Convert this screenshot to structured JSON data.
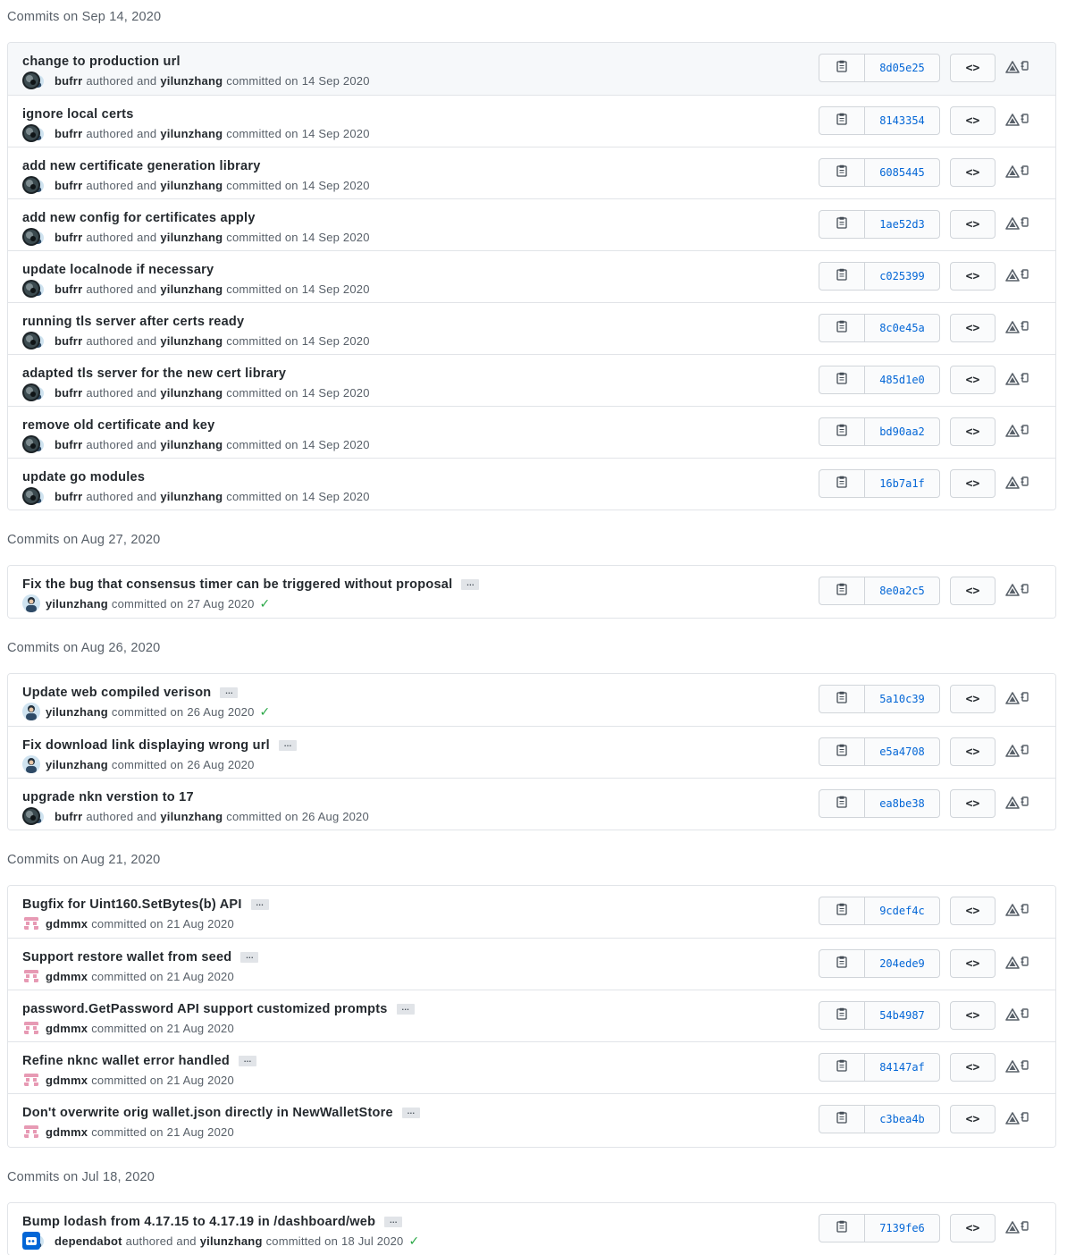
{
  "groups": [
    {
      "header": "Commits on Sep 14, 2020",
      "commits": [
        {
          "message": "change to production url",
          "ellipsis": false,
          "authors": [
            "bufrr",
            "yilunzhang"
          ],
          "date": "14 Sep 2020",
          "verified": false,
          "sha": "8d05e25",
          "avatar": "dark"
        },
        {
          "message": "ignore local certs",
          "ellipsis": false,
          "authors": [
            "bufrr",
            "yilunzhang"
          ],
          "date": "14 Sep 2020",
          "verified": false,
          "sha": "8143354",
          "avatar": "dark"
        },
        {
          "message": "add new certificate generation library",
          "ellipsis": false,
          "authors": [
            "bufrr",
            "yilunzhang"
          ],
          "date": "14 Sep 2020",
          "verified": false,
          "sha": "6085445",
          "avatar": "dark"
        },
        {
          "message": "add new config for certificates apply",
          "ellipsis": false,
          "authors": [
            "bufrr",
            "yilunzhang"
          ],
          "date": "14 Sep 2020",
          "verified": false,
          "sha": "1ae52d3",
          "avatar": "dark"
        },
        {
          "message": "update localnode if necessary",
          "ellipsis": false,
          "authors": [
            "bufrr",
            "yilunzhang"
          ],
          "date": "14 Sep 2020",
          "verified": false,
          "sha": "c025399",
          "avatar": "dark"
        },
        {
          "message": "running tls server after certs ready",
          "ellipsis": false,
          "authors": [
            "bufrr",
            "yilunzhang"
          ],
          "date": "14 Sep 2020",
          "verified": false,
          "sha": "8c0e45a",
          "avatar": "dark"
        },
        {
          "message": "adapted tls server for the new cert library",
          "ellipsis": false,
          "authors": [
            "bufrr",
            "yilunzhang"
          ],
          "date": "14 Sep 2020",
          "verified": false,
          "sha": "485d1e0",
          "avatar": "dark"
        },
        {
          "message": "remove old certificate and key",
          "ellipsis": false,
          "authors": [
            "bufrr",
            "yilunzhang"
          ],
          "date": "14 Sep 2020",
          "verified": false,
          "sha": "bd90aa2",
          "avatar": "dark"
        },
        {
          "message": "update go modules",
          "ellipsis": false,
          "authors": [
            "bufrr",
            "yilunzhang"
          ],
          "date": "14 Sep 2020",
          "verified": false,
          "sha": "16b7a1f",
          "avatar": "dark"
        }
      ]
    },
    {
      "header": "Commits on Aug 27, 2020",
      "commits": [
        {
          "message": "Fix the bug that consensus timer can be triggered without proposal",
          "ellipsis": true,
          "authors": [
            "yilunzhang"
          ],
          "date": "27 Aug 2020",
          "verified": true,
          "sha": "8e0a2c5",
          "avatar": "person"
        }
      ]
    },
    {
      "header": "Commits on Aug 26, 2020",
      "commits": [
        {
          "message": "Update web compiled verison",
          "ellipsis": true,
          "authors": [
            "yilunzhang"
          ],
          "date": "26 Aug 2020",
          "verified": true,
          "sha": "5a10c39",
          "avatar": "person"
        },
        {
          "message": "Fix download link displaying wrong url",
          "ellipsis": true,
          "authors": [
            "yilunzhang"
          ],
          "date": "26 Aug 2020",
          "verified": false,
          "sha": "e5a4708",
          "avatar": "person"
        },
        {
          "message": "upgrade nkn verstion to 17",
          "ellipsis": false,
          "authors": [
            "bufrr",
            "yilunzhang"
          ],
          "date": "26 Aug 2020",
          "verified": false,
          "sha": "ea8be38",
          "avatar": "dark"
        }
      ]
    },
    {
      "header": "Commits on Aug 21, 2020",
      "commits": [
        {
          "message": "Bugfix for Uint160.SetBytes(b) API",
          "ellipsis": true,
          "authors": [
            "gdmmx"
          ],
          "date": "21 Aug 2020",
          "verified": false,
          "sha": "9cdef4c",
          "avatar": "pink"
        },
        {
          "message": "Support restore wallet from seed",
          "ellipsis": true,
          "authors": [
            "gdmmx"
          ],
          "date": "21 Aug 2020",
          "verified": false,
          "sha": "204ede9",
          "avatar": "pink"
        },
        {
          "message": "password.GetPassword API support customized prompts",
          "ellipsis": true,
          "authors": [
            "gdmmx"
          ],
          "date": "21 Aug 2020",
          "verified": false,
          "sha": "54b4987",
          "avatar": "pink"
        },
        {
          "message": "Refine nknc wallet error handled",
          "ellipsis": true,
          "authors": [
            "gdmmx"
          ],
          "date": "21 Aug 2020",
          "verified": false,
          "sha": "84147af",
          "avatar": "pink"
        },
        {
          "message": "Don't overwrite orig wallet.json directly in NewWalletStore",
          "ellipsis": true,
          "authors": [
            "gdmmx"
          ],
          "date": "21 Aug 2020",
          "verified": false,
          "sha": "c3bea4b",
          "avatar": "pink"
        }
      ]
    },
    {
      "header": "Commits on Jul 18, 2020",
      "commits": [
        {
          "message": "Bump lodash from 4.17.15 to 4.17.19 in /dashboard/web",
          "ellipsis": true,
          "authors": [
            "dependabot",
            "yilunzhang"
          ],
          "date": "18 Jul 2020",
          "verified": true,
          "sha": "7139fe6",
          "avatar": "bot"
        }
      ]
    }
  ],
  "labels": {
    "authored_and": "authored and",
    "committed_on": "committed on",
    "ellipsis": "…",
    "browse": "<>",
    "check": "✓"
  },
  "colors": {
    "link": "#0366d6",
    "verified": "#28a745",
    "border": "#e1e4e8",
    "muted": "#586069"
  },
  "icons": {
    "copy": "clipboard-icon",
    "browse": "code-icon",
    "extension": "extension-icons"
  }
}
